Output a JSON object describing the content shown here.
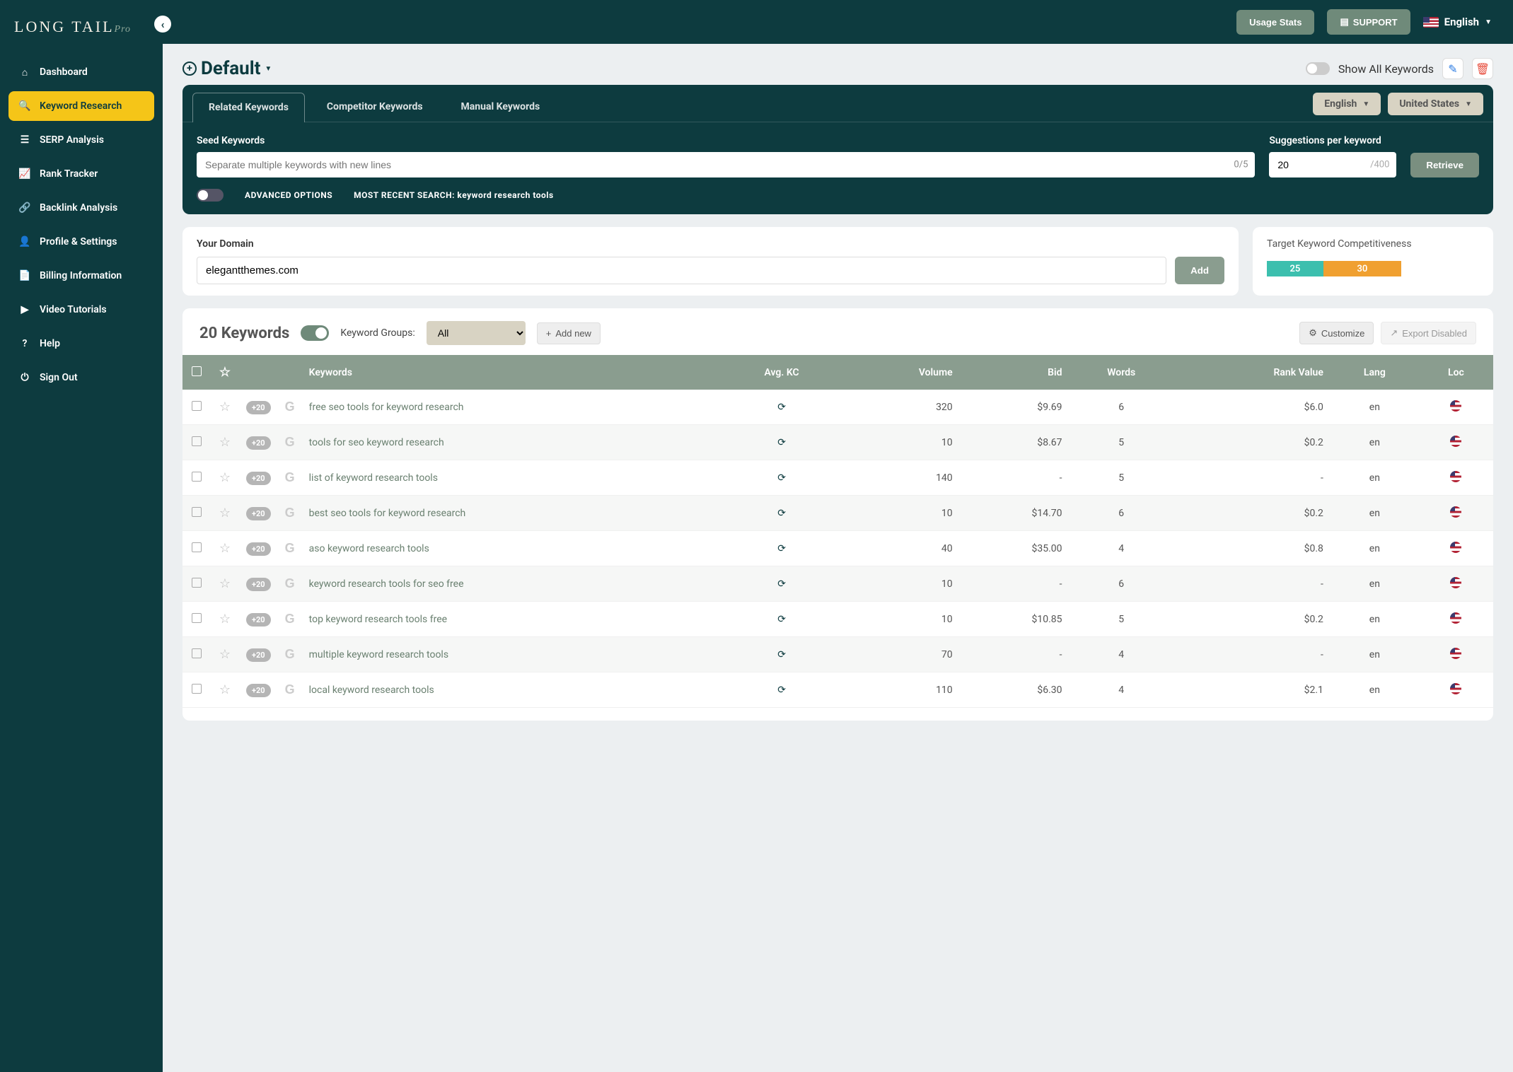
{
  "brand": {
    "name": "LONG TAIL",
    "suffix": "Pro"
  },
  "topbar": {
    "usage": "Usage Stats",
    "support": "SUPPORT",
    "language": "English"
  },
  "sidebar": {
    "items": [
      {
        "label": "Dashboard",
        "icon": "home"
      },
      {
        "label": "Keyword Research",
        "icon": "search",
        "active": true
      },
      {
        "label": "SERP Analysis",
        "icon": "list"
      },
      {
        "label": "Rank Tracker",
        "icon": "chart"
      },
      {
        "label": "Backlink Analysis",
        "icon": "link"
      },
      {
        "label": "Profile & Settings",
        "icon": "user"
      },
      {
        "label": "Billing Information",
        "icon": "doc"
      },
      {
        "label": "Video Tutorials",
        "icon": "video"
      },
      {
        "label": "Help",
        "icon": "help"
      },
      {
        "label": "Sign Out",
        "icon": "power"
      }
    ]
  },
  "project": {
    "name": "Default",
    "show_all_label": "Show All Keywords"
  },
  "search": {
    "tabs": [
      "Related Keywords",
      "Competitor Keywords",
      "Manual Keywords"
    ],
    "lang_filter": "English",
    "country_filter": "United States",
    "seed_label": "Seed Keywords",
    "seed_placeholder": "Separate multiple keywords with new lines",
    "seed_counter": "0/5",
    "sugg_label": "Suggestions per keyword",
    "sugg_value": "20",
    "sugg_max": "/400",
    "retrieve": "Retrieve",
    "adv_label": "ADVANCED OPTIONS",
    "recent_label": "MOST RECENT SEARCH: keyword research tools"
  },
  "domain": {
    "label": "Your Domain",
    "value": "elegantthemes.com",
    "add": "Add"
  },
  "kc": {
    "label": "Target Keyword Competitiveness",
    "v1": "25",
    "v2": "30"
  },
  "results": {
    "count_label": "20 Keywords",
    "group_label": "Keyword Groups:",
    "group_value": "All",
    "add_new": "Add new",
    "customize": "Customize",
    "export": "Export Disabled",
    "plus20": "+20",
    "columns": [
      "Keywords",
      "Avg. KC",
      "Volume",
      "Bid",
      "Words",
      "Rank Value",
      "Lang",
      "Loc"
    ],
    "rows": [
      {
        "kw": "free seo tools for keyword research",
        "vol": "320",
        "bid": "$9.69",
        "words": "6",
        "rank": "$6.0",
        "lang": "en"
      },
      {
        "kw": "tools for seo keyword research",
        "vol": "10",
        "bid": "$8.67",
        "words": "5",
        "rank": "$0.2",
        "lang": "en"
      },
      {
        "kw": "list of keyword research tools",
        "vol": "140",
        "bid": "-",
        "words": "5",
        "rank": "-",
        "lang": "en"
      },
      {
        "kw": "best seo tools for keyword research",
        "vol": "10",
        "bid": "$14.70",
        "words": "6",
        "rank": "$0.2",
        "lang": "en"
      },
      {
        "kw": "aso keyword research tools",
        "vol": "40",
        "bid": "$35.00",
        "words": "4",
        "rank": "$0.8",
        "lang": "en"
      },
      {
        "kw": "keyword research tools for seo free",
        "vol": "10",
        "bid": "-",
        "words": "6",
        "rank": "-",
        "lang": "en"
      },
      {
        "kw": "top keyword research tools free",
        "vol": "10",
        "bid": "$10.85",
        "words": "5",
        "rank": "$0.2",
        "lang": "en"
      },
      {
        "kw": "multiple keyword research tools",
        "vol": "70",
        "bid": "-",
        "words": "4",
        "rank": "-",
        "lang": "en"
      },
      {
        "kw": "local keyword research tools",
        "vol": "110",
        "bid": "$6.30",
        "words": "4",
        "rank": "$2.1",
        "lang": "en"
      }
    ]
  }
}
